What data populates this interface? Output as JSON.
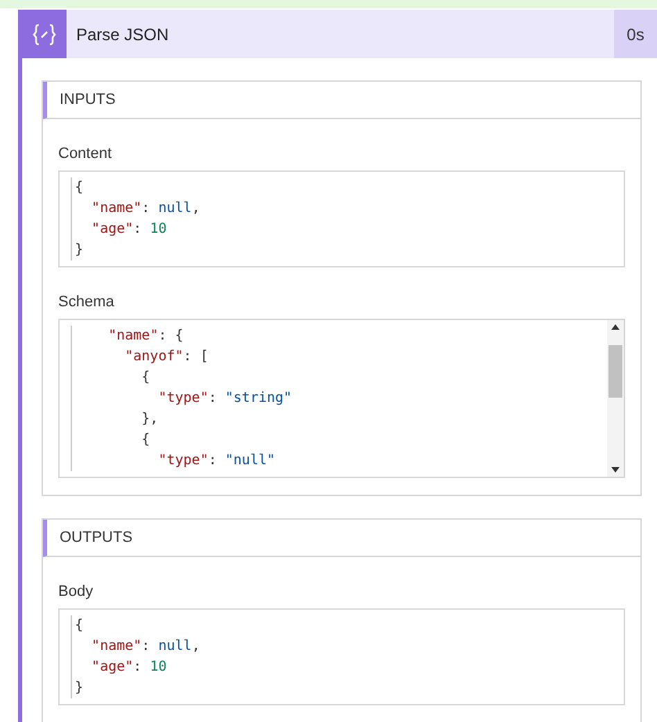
{
  "action": {
    "title": "Parse JSON",
    "duration": "0s"
  },
  "sections": [
    {
      "title": "INPUTS",
      "fields": [
        {
          "label": "Content",
          "scrollable": false,
          "lines": [
            "{",
            "  \"name\": null,",
            "  \"age\": 10",
            "}"
          ]
        },
        {
          "label": "Schema",
          "scrollable": true,
          "lines": [
            "    \"name\": {",
            "      \"anyof\": [",
            "        {",
            "          \"type\": \"string\"",
            "        },",
            "        {",
            "          \"type\": \"null\""
          ]
        }
      ]
    },
    {
      "title": "OUTPUTS",
      "fields": [
        {
          "label": "Body",
          "scrollable": false,
          "lines": [
            "{",
            "  \"name\": null,",
            "  \"age\": 10",
            "}"
          ]
        }
      ]
    }
  ]
}
